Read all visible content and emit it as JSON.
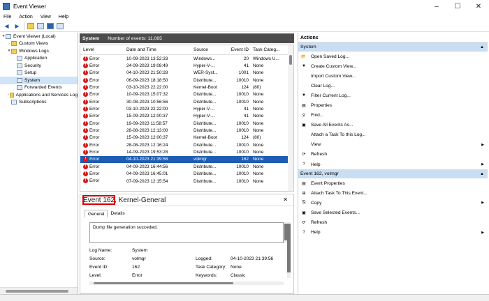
{
  "window": {
    "title": "Event Viewer"
  },
  "menu": [
    "File",
    "Action",
    "View",
    "Help"
  ],
  "tree": [
    {
      "label": "Event Viewer (Local)",
      "indent": 0,
      "twisty": "▼",
      "folder": false
    },
    {
      "label": "Custom Views",
      "indent": 1,
      "twisty": "›",
      "folder": true
    },
    {
      "label": "Windows Logs",
      "indent": 1,
      "twisty": "▼",
      "folder": true
    },
    {
      "label": "Application",
      "indent": 2,
      "twisty": "",
      "folder": false
    },
    {
      "label": "Security",
      "indent": 2,
      "twisty": "",
      "folder": false
    },
    {
      "label": "Setup",
      "indent": 2,
      "twisty": "",
      "folder": false
    },
    {
      "label": "System",
      "indent": 2,
      "twisty": "",
      "folder": false,
      "selected": true
    },
    {
      "label": "Forwarded Events",
      "indent": 2,
      "twisty": "",
      "folder": false
    },
    {
      "label": "Applications and Services Log",
      "indent": 1,
      "twisty": "›",
      "folder": true
    },
    {
      "label": "Subscriptions",
      "indent": 1,
      "twisty": "",
      "folder": false
    }
  ],
  "center": {
    "log_name": "System",
    "count_text": "Number of events: 11,085"
  },
  "table": {
    "headers": [
      "Level",
      "Date and Time",
      "Source",
      "Event ID",
      "Task Categ..."
    ],
    "rows": [
      [
        "Error",
        "10-09-2023 13:52:33",
        "Windows...",
        "20",
        "Windows U..."
      ],
      [
        "Error",
        "24-09-2023 19:08:49",
        "Hyper-V-...",
        "41",
        "None"
      ],
      [
        "Error",
        "04-10-2023 21:50:28",
        "WER-Syst...",
        "1001",
        "None"
      ],
      [
        "Error",
        "06-09-2023 18:18:50",
        "Distribute...",
        "10010",
        "None"
      ],
      [
        "Error",
        "03-10-2023 22:22:00",
        "Kernel-Boot",
        "124",
        "(80)"
      ],
      [
        "Error",
        "10-09-2023 15:07:32",
        "Distribute...",
        "10010",
        "None"
      ],
      [
        "Error",
        "30-08-2023 10:56:56",
        "Distribute...",
        "10010",
        "None"
      ],
      [
        "Error",
        "03-10-2023 22:22:00",
        "Hyper-V-...",
        "41",
        "None"
      ],
      [
        "Error",
        "15-09-2023 12:00:37",
        "Hyper-V-...",
        "41",
        "None"
      ],
      [
        "Error",
        "19-09-2023 11:58:57",
        "Distribute...",
        "10010",
        "None"
      ],
      [
        "Error",
        "28-08-2023 12:13:00",
        "Distribute...",
        "10010",
        "None"
      ],
      [
        "Error",
        "15-09-2023 12:00:37",
        "Kernel-Boot",
        "124",
        "(80)"
      ],
      [
        "Error",
        "28-08-2023 12:16:24",
        "Distribute...",
        "10010",
        "None"
      ],
      [
        "Error",
        "14-09-2023 19:53:28",
        "Distribute...",
        "10010",
        "None"
      ],
      [
        "Error",
        "04-10-2023 21:39:56",
        "volmgr",
        "162",
        "None"
      ],
      [
        "Error",
        "04-09-2023 16:44:56",
        "Distribute...",
        "10010",
        "None"
      ],
      [
        "Error",
        "04-09-2023 16:45:01",
        "Distribute...",
        "10010",
        "None"
      ],
      [
        "Error",
        "07-09-2023 12:15:54",
        "Distribute...",
        "10010",
        "None"
      ]
    ],
    "selected_index": 14
  },
  "details": {
    "title": "Event 162, Kernel-General",
    "close_glyph": "✕",
    "tabs": [
      "General",
      "Details"
    ],
    "message": "Dump file generation succeded.",
    "fields": {
      "log_name_label": "Log Name:",
      "log_name": "System",
      "source_label": "Source:",
      "source": "volmgr",
      "event_id_label": "Event ID:",
      "event_id": "162",
      "level_label": "Level:",
      "level": "Error",
      "logged_label": "Logged:",
      "logged": "04-10-2023 21:39:56",
      "task_label": "Task Category:",
      "task": "None",
      "keywords_label": "Keywords:",
      "keywords": "Classic"
    }
  },
  "actions": {
    "title": "Actions",
    "section1": "System",
    "items1": [
      {
        "label": "Open Saved Log...",
        "icon": "📂"
      },
      {
        "label": "Create Custom View...",
        "icon": "▼"
      },
      {
        "label": "Import Custom View...",
        "icon": ""
      },
      {
        "label": "Clear Log...",
        "icon": ""
      },
      {
        "label": "Filter Current Log...",
        "icon": "▼"
      },
      {
        "label": "Properties",
        "icon": "▤"
      },
      {
        "label": "Find...",
        "icon": "⚲"
      },
      {
        "label": "Save All Events As...",
        "icon": "▣"
      },
      {
        "label": "Attach a Task To this Log...",
        "icon": ""
      },
      {
        "label": "View",
        "icon": "",
        "submenu": true
      },
      {
        "label": "Refresh",
        "icon": "⟳"
      },
      {
        "label": "Help",
        "icon": "?",
        "submenu": true
      }
    ],
    "section2": "Event 162, volmgr",
    "items2": [
      {
        "label": "Event Properties",
        "icon": "▤"
      },
      {
        "label": "Attach Task To This Event...",
        "icon": "⊞"
      },
      {
        "label": "Copy",
        "icon": "⎘",
        "submenu": true
      },
      {
        "label": "Save Selected Events...",
        "icon": "▣"
      },
      {
        "label": "Refresh",
        "icon": "⟳"
      },
      {
        "label": "Help",
        "icon": "?",
        "submenu": true
      }
    ]
  },
  "colors": {
    "selected_row": "#1e5db3",
    "section_bg": "#c9ddf3",
    "header_bg": "#4c4c4c",
    "highlight": "#d40000"
  }
}
